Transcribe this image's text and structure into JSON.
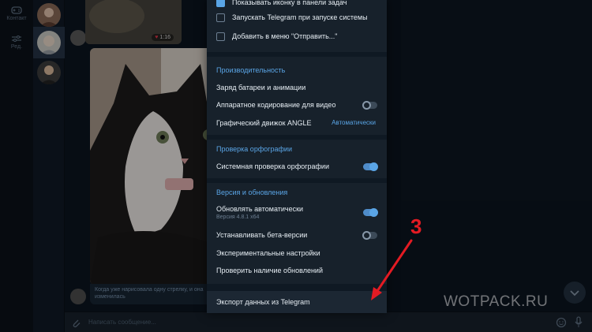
{
  "rail": {
    "items": [
      {
        "label": "Контакт",
        "icon": "gamepad-icon"
      },
      {
        "label": "Ред.",
        "icon": "sliders-icon"
      }
    ]
  },
  "chat": {
    "photo_time": "1:16",
    "caption": "Когда уже нарисовала одну стрелку, и она изменилась",
    "input_placeholder": "Написать сообщение..."
  },
  "settings": {
    "top_items": [
      {
        "label": "Показывать иконку в панели задач",
        "checked": true
      },
      {
        "label": "Запускать Telegram при запуске системы",
        "checked": false
      },
      {
        "label": "Добавить в меню \"Отправить...\"",
        "checked": false
      }
    ],
    "performance": {
      "title": "Производительность",
      "battery": "Заряд батареи и анимации",
      "hw_encoding": "Аппаратное кодирование для видео",
      "hw_encoding_on": false,
      "angle_label": "Графический движок ANGLE",
      "angle_value": "Автоматически"
    },
    "spelling": {
      "title": "Проверка орфографии",
      "system_check": "Системная проверка орфографии",
      "system_check_on": true
    },
    "updates": {
      "title": "Версия и обновления",
      "auto_update": "Обновлять автоматически",
      "version": "Версия 4.8.1 x64",
      "auto_update_on": true,
      "beta": "Устанавливать бета-версии",
      "beta_on": false,
      "experimental": "Экспериментальные настройки",
      "check_updates": "Проверить наличие обновлений"
    },
    "export": "Экспорт данных из Telegram"
  },
  "annotation": {
    "number": "3",
    "color": "#e31b23"
  },
  "watermark": "WOTPACK.RU",
  "colors": {
    "accent": "#5aa5e6",
    "panel_bg": "#17212b",
    "app_bg": "#0e1621"
  }
}
